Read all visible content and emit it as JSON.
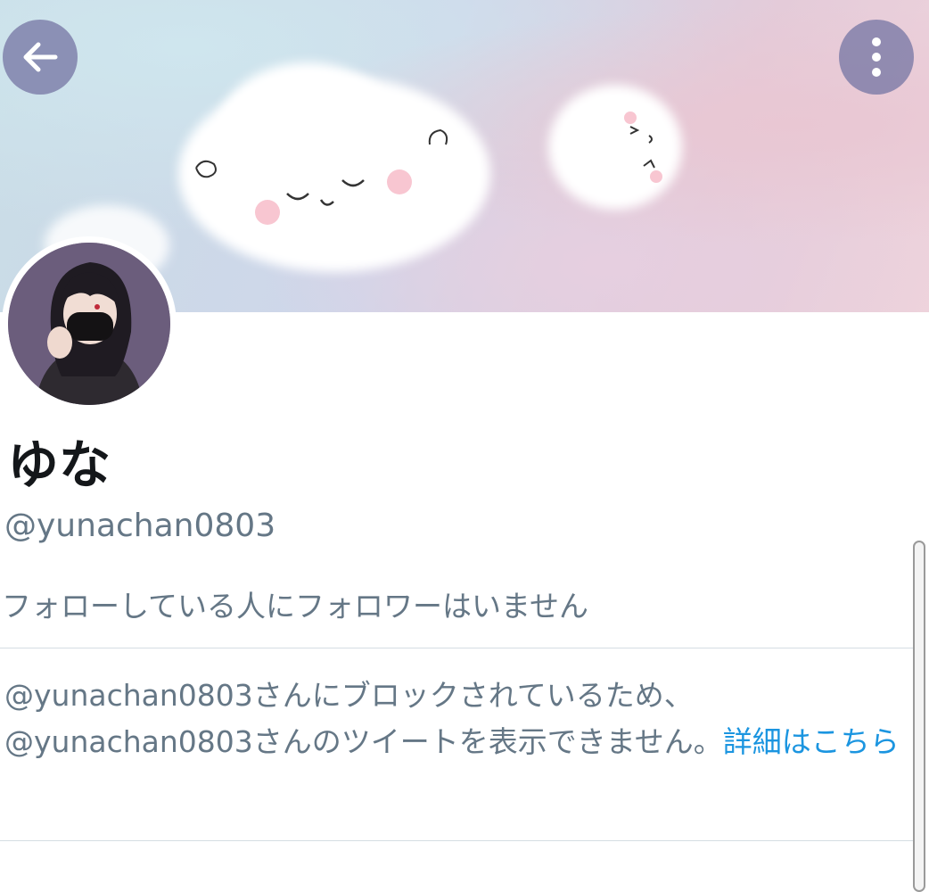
{
  "profile": {
    "display_name": "ゆな",
    "handle": "@yunachan0803",
    "followers_you_follow": "フォローしている人にフォロワーはいません"
  },
  "blocked_notice": {
    "line1": "@yunachan0803さんにブロックされているため、",
    "line2": "@yunachan0803さんのツイートを表示できません。",
    "learn_more": "詳細はこちら"
  },
  "nav": {
    "back_icon": "arrow-left-icon",
    "more_icon": "more-vertical-icon"
  },
  "colors": {
    "link": "#1b95e0",
    "secondary_text": "#657786",
    "primary_text": "#14171a",
    "nav_button_bg": "#7878a5"
  }
}
